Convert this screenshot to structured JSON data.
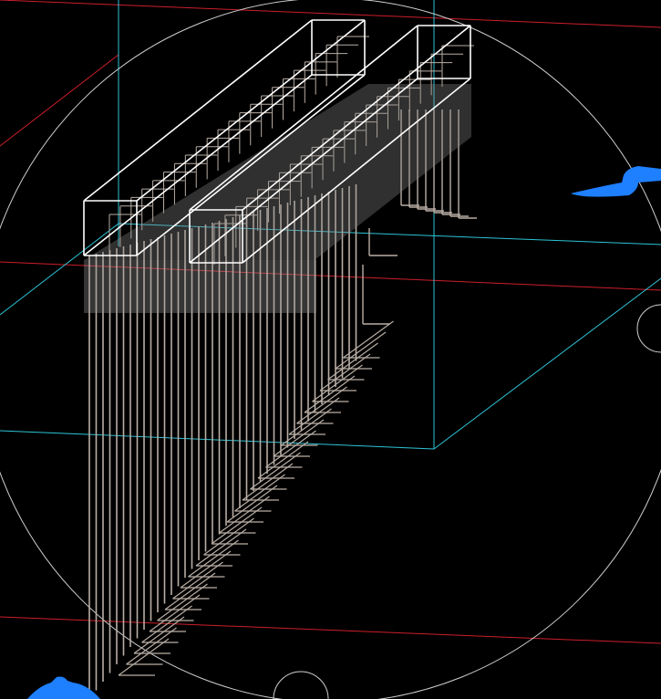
{
  "viewport": {
    "background": "#000000",
    "orbit_color": "#cfcfcf",
    "grid_color": "#cc1f2a",
    "box_color": "#2ec4d6",
    "beam_color": "#ffffff",
    "rebar_color": "#b9aea5",
    "gizmo_color": "#1e7fff"
  }
}
